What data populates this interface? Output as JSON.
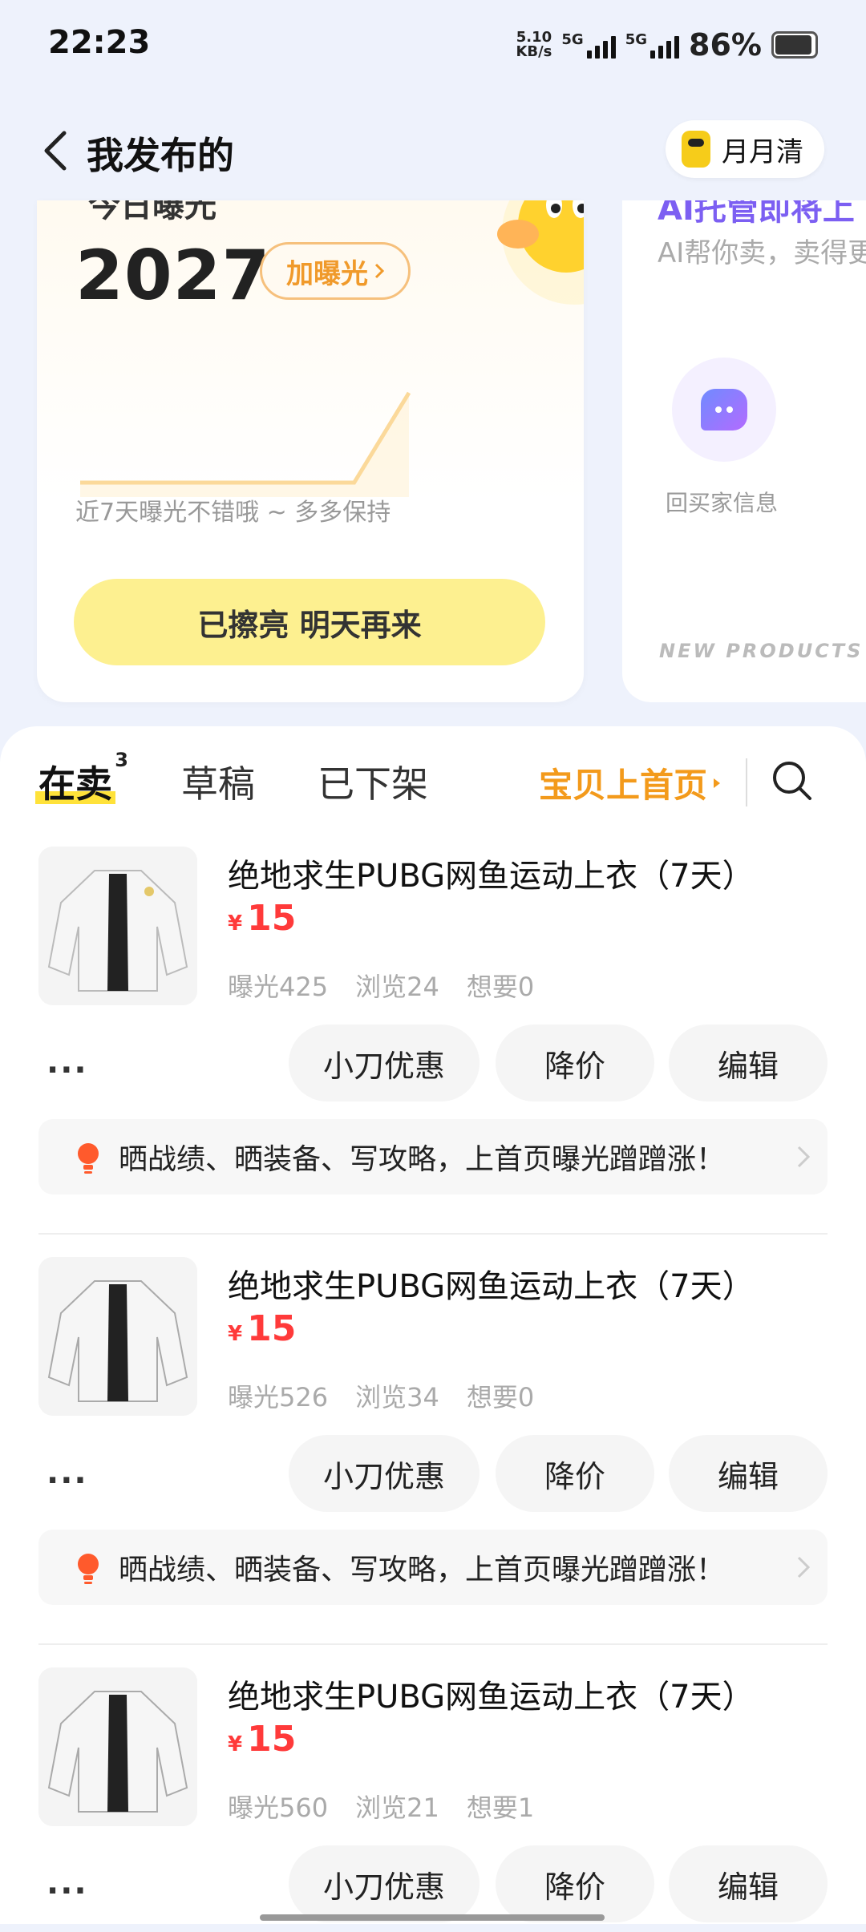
{
  "status_bar": {
    "time": "22:23",
    "net_speed_value": "5.10",
    "net_speed_unit": "KB/s",
    "signal1_label": "5G",
    "signal2_label": "5G",
    "battery_percent": "86%",
    "battery_level": 0.86
  },
  "header": {
    "back_icon": "chevron-left-icon",
    "title": "我发布的",
    "user_name": "月月清"
  },
  "stat_card": {
    "label_partial": "今日曝光",
    "exposure": "2027",
    "boost_label": "加曝光",
    "caption": "近7天曝光不错哦 ~ 多多保持",
    "done_button": "已擦亮 明天再来",
    "trend": [
      0,
      0,
      0,
      0,
      0,
      0,
      1
    ]
  },
  "ai_card": {
    "title_partial": "AI托管即将上",
    "subtitle": "AI帮你卖，卖得更",
    "reply_label": "回买家信息",
    "watermark": "NEW PRODUCTS CO"
  },
  "tabs": [
    {
      "label": "在卖",
      "count": "3"
    },
    {
      "label": "草稿",
      "count": ""
    },
    {
      "label": "已下架",
      "count": ""
    }
  ],
  "promo_link": "宝贝上首页",
  "items": [
    {
      "title": "绝地求生PUBG网鱼运动上衣（7天）",
      "currency": "¥",
      "price": "15",
      "exposure": "曝光425",
      "views": "浏览24",
      "wants": "想要0",
      "more": "···",
      "action1": "小刀优惠",
      "action2": "降价",
      "action3": "编辑",
      "tip": "晒战绩、晒装备、写攻略，上首页曝光蹭蹭涨！"
    },
    {
      "title": "绝地求生PUBG网鱼运动上衣（7天）",
      "currency": "¥",
      "price": "15",
      "exposure": "曝光526",
      "views": "浏览34",
      "wants": "想要0",
      "more": "···",
      "action1": "小刀优惠",
      "action2": "降价",
      "action3": "编辑",
      "tip": "晒战绩、晒装备、写攻略，上首页曝光蹭蹭涨！"
    },
    {
      "title": "绝地求生PUBG网鱼运动上衣（7天）",
      "currency": "¥",
      "price": "15",
      "exposure": "曝光560",
      "views": "浏览21",
      "wants": "想要1",
      "more": "···",
      "action1": "小刀优惠",
      "action2": "降价",
      "action3": "编辑",
      "tip": ""
    }
  ],
  "colors": {
    "accent_yellow": "#ffe23a",
    "price_red": "#ff3a3a",
    "promo_orange": "#f39a1b"
  }
}
